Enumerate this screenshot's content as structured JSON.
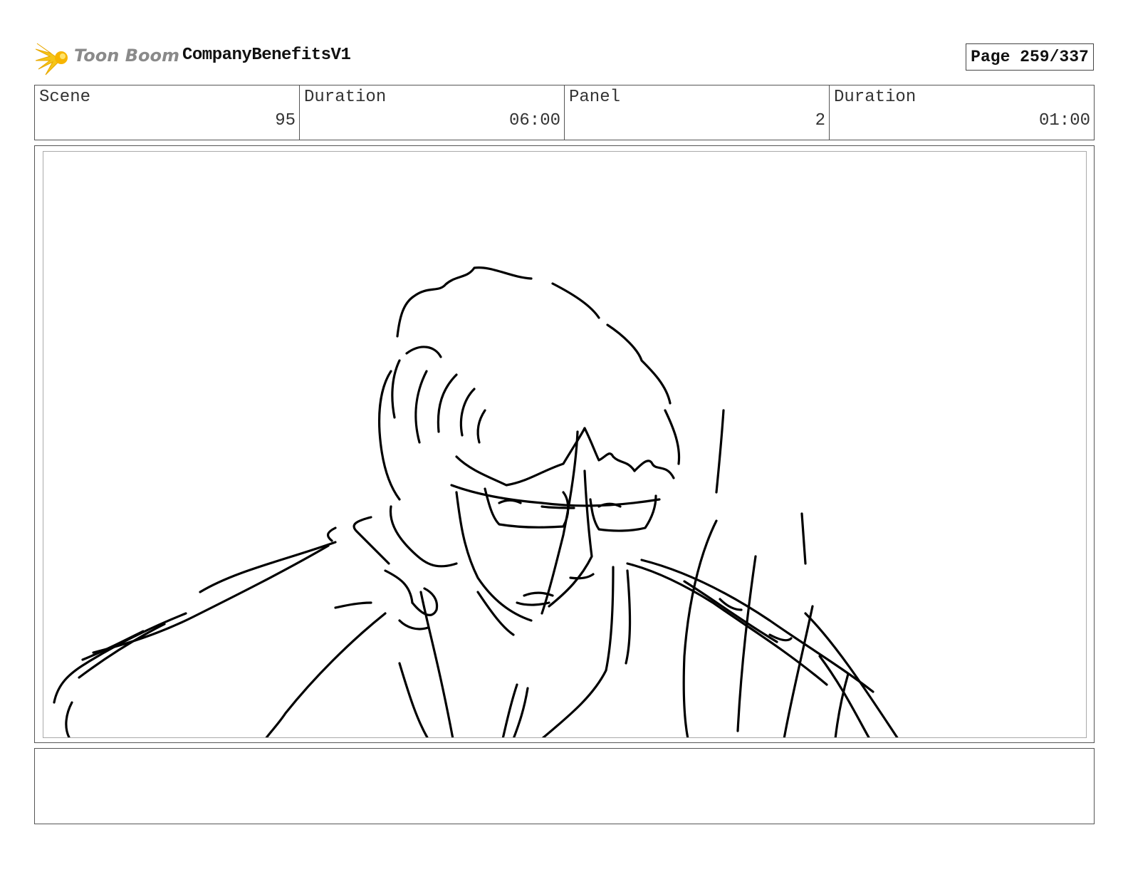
{
  "header": {
    "logo_text": "Toon Boom",
    "project_title": "CompanyBenefitsV1",
    "page_label": "Page 259/337"
  },
  "info": {
    "scene_label": "Scene",
    "scene_value": "95",
    "scene_duration_label": "Duration",
    "scene_duration_value": "06:00",
    "panel_label": "Panel",
    "panel_value": "2",
    "panel_duration_label": "Duration",
    "panel_duration_value": "01:00"
  },
  "panel": {
    "sketch_subject": "man with glasses looking down, hand on head"
  },
  "notes": {
    "text": ""
  },
  "colors": {
    "logo_star": "#f5c518",
    "logo_text": "#8a8a8a",
    "border": "#555555",
    "sketch_line": "#000000"
  }
}
